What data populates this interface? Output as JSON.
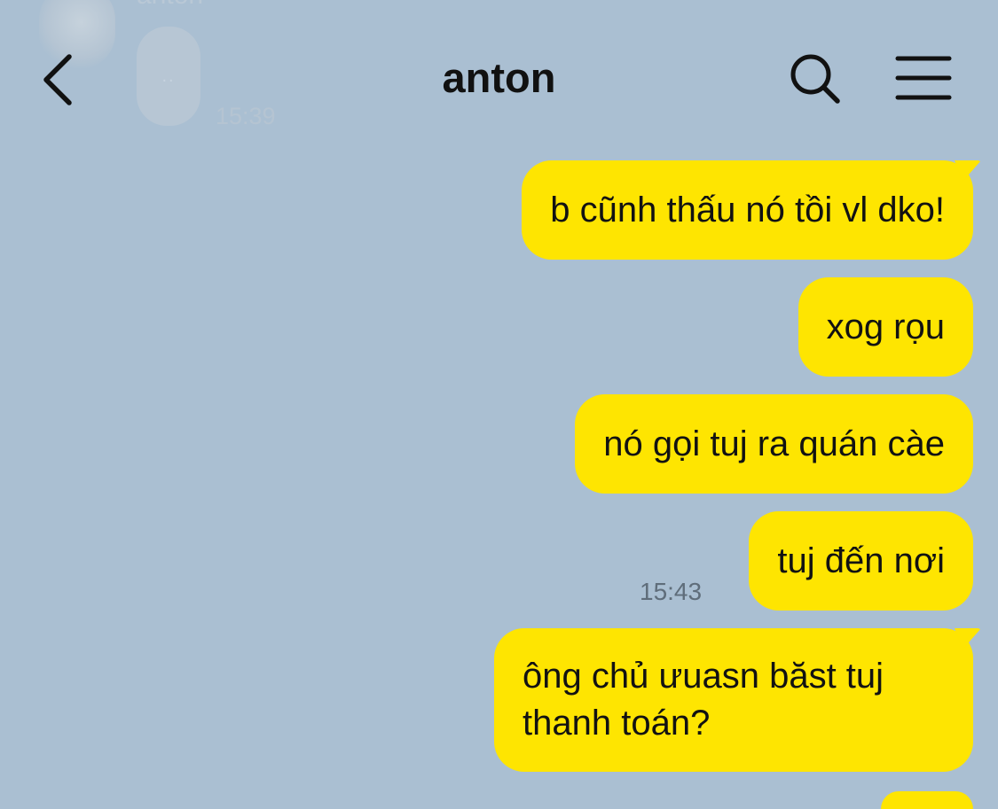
{
  "background_message": {
    "sender": "anton",
    "text": "..",
    "time": "15:39"
  },
  "header": {
    "title": "anton",
    "back_icon": "chevron-left-icon",
    "search_icon": "search-icon",
    "menu_icon": "hamburger-menu-icon"
  },
  "messages": [
    {
      "text": "b cũnh thấu nó tồi vl dko!"
    },
    {
      "text": "xog rọu"
    },
    {
      "text": "nó gọi tuj ra quán càe"
    },
    {
      "text": "tuj đến nơi",
      "time": "15:43"
    },
    {
      "text": "ông chủ ưuasn băst tuj thanh toán?"
    }
  ],
  "colors": {
    "background": "#aabfd2",
    "my_bubble": "#fee501",
    "title_text": "#111111",
    "timestamp_text": "#5f6d7a"
  }
}
